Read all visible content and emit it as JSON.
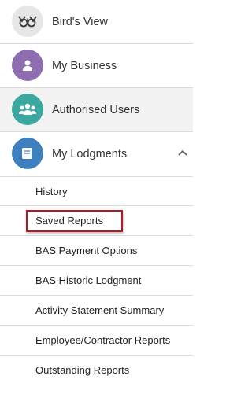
{
  "menu": {
    "main_items": [
      {
        "label": "Bird's View",
        "icon": "binoculars-icon",
        "color": "#e6e6e6"
      },
      {
        "label": "My Business",
        "icon": "user-icon",
        "color": "#8e6eb0"
      },
      {
        "label": "Authorised Users",
        "icon": "users-icon",
        "color": "#3aa7a0"
      },
      {
        "label": "My Lodgments",
        "icon": "book-icon",
        "color": "#3d7fbf"
      }
    ],
    "expanded_section": "My Lodgments",
    "sub_items": [
      {
        "label": "History"
      },
      {
        "label": "Saved Reports",
        "highlighted": true
      },
      {
        "label": "BAS Payment Options"
      },
      {
        "label": "BAS Historic Lodgment"
      },
      {
        "label": "Activity Statement Summary"
      },
      {
        "label": "Employee/Contractor Reports"
      },
      {
        "label": "Outstanding Reports"
      }
    ],
    "highlight_color": "#b21a28"
  }
}
